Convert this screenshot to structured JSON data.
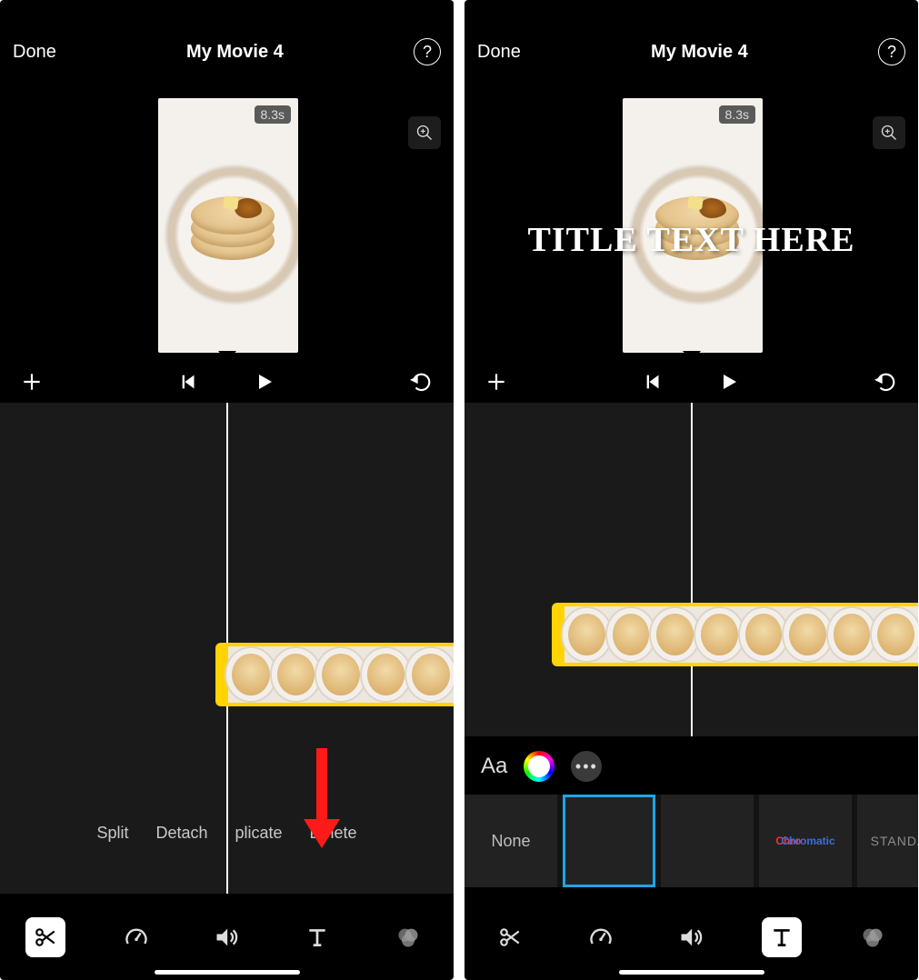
{
  "left": {
    "header": {
      "done": "Done",
      "title": "My Movie 4"
    },
    "duration_badge": "8.3s",
    "clip_actions": {
      "split": "Split",
      "detach": "Detach",
      "duplicate": "plicate",
      "delete": "Delete"
    },
    "toolbar_active": "scissors"
  },
  "right": {
    "header": {
      "done": "Done",
      "title": "My Movie 4"
    },
    "duration_badge": "8.3s",
    "overlay_text": "TITLE TEXT HERE",
    "clip_t_indicator": "T",
    "style_controls": {
      "font_label": "Aa"
    },
    "title_presets": {
      "none": "None",
      "chromatic_a": "Chro",
      "chromatic_b": "Chromatic",
      "standard": "STANDAR"
    },
    "toolbar_active": "text"
  }
}
